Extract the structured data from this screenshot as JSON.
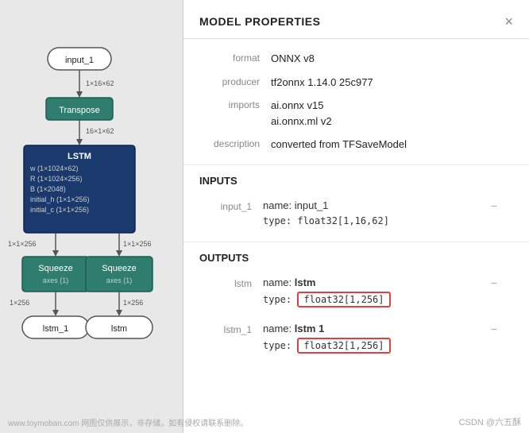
{
  "panel": {
    "title": "MODEL PROPERTIES",
    "close_label": "×"
  },
  "properties": {
    "format_label": "format",
    "format_value": "ONNX v8",
    "producer_label": "producer",
    "producer_value": "tf2onnx 1.14.0 25c977",
    "imports_label": "imports",
    "imports_value1": "ai.onnx v15",
    "imports_value2": "ai.onnx.ml v2",
    "description_label": "description",
    "description_value": "converted from TFSaveModel"
  },
  "inputs_section": {
    "title": "INPUTS",
    "items": [
      {
        "id": "input_1",
        "name_label": "name:",
        "name_value": "input_1",
        "type_label": "type:",
        "type_value": "float32[1,16,62]",
        "highlighted": false
      }
    ]
  },
  "outputs_section": {
    "title": "OUTPUTS",
    "items": [
      {
        "id": "lstm",
        "name_label": "name:",
        "name_value": "lstm",
        "type_label": "type:",
        "type_value": "float32[1,256]",
        "highlighted": true
      },
      {
        "id": "lstm_1",
        "name_label": "name:",
        "name_value": "lstm 1",
        "name_bold": true,
        "type_label": "type:",
        "type_value": "float32[1,256]",
        "highlighted": true
      }
    ]
  },
  "graph": {
    "nodes": [
      {
        "id": "input_1",
        "label": "input_1",
        "type": "input"
      },
      {
        "id": "transpose",
        "label": "Transpose",
        "type": "green"
      },
      {
        "id": "lstm",
        "label": "LSTM",
        "type": "blue",
        "details": [
          "w  (1×1024×62)",
          "R  (1×1024×256)",
          "B  (1×2048)",
          "initial_h  (1×1×256)",
          "initial_c  (1×1×256)"
        ]
      },
      {
        "id": "squeeze1",
        "label": "Squeeze",
        "type": "teal",
        "detail": "axes (1)"
      },
      {
        "id": "squeeze2",
        "label": "Squeeze",
        "type": "teal",
        "detail": "axes (1)"
      },
      {
        "id": "lstm_out",
        "label": "lstm",
        "type": "input"
      },
      {
        "id": "lstm_1_out",
        "label": "lstm_1",
        "type": "input"
      }
    ],
    "edges": [
      {
        "from": "input_1",
        "to": "transpose",
        "label": "1×16×62"
      },
      {
        "from": "transpose",
        "to": "lstm",
        "label": "16×1×62"
      },
      {
        "from": "lstm",
        "to": "squeeze1",
        "label": "1×1×256"
      },
      {
        "from": "lstm",
        "to": "squeeze2",
        "label": "1×1×256"
      },
      {
        "from": "squeeze1",
        "to": "lstm_1_out",
        "label": "1×256"
      },
      {
        "from": "squeeze2",
        "to": "lstm_out",
        "label": "1×256"
      }
    ]
  },
  "watermark": {
    "left": "www.toymoban.com 网图仅供展示，非存储，如有侵权请联系删除。",
    "right": "CSDN @六五酥"
  }
}
